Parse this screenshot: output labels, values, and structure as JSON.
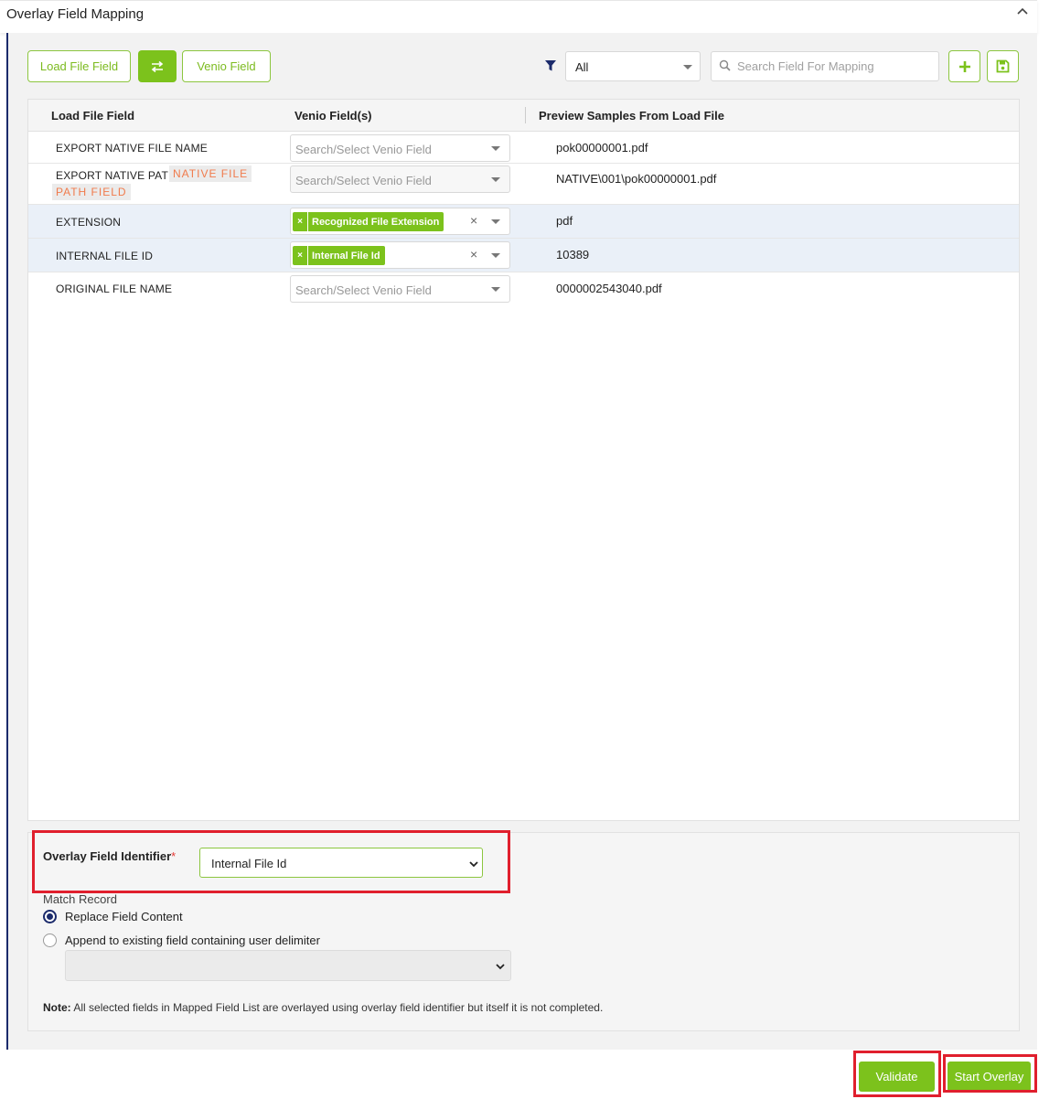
{
  "section": {
    "title": "Overlay Field Mapping"
  },
  "toolbar": {
    "load_file_field_label": "Load File Field",
    "venio_field_label": "Venio Field",
    "filter_value": "All",
    "search_placeholder": "Search Field For Mapping"
  },
  "grid": {
    "headers": {
      "load_file_field": "Load File Field",
      "venio_fields": "Venio Field(s)",
      "preview": "Preview Samples From Load File"
    },
    "rows": [
      {
        "name": "EXPORT NATIVE FILE NAME",
        "venio_placeholder": "Search/Select Venio Field",
        "preview": "pok00000001.pdf"
      },
      {
        "name": "EXPORT NATIVE PATH",
        "tag_line1": "NATIVE FILE",
        "tag_line2": "PATH FIELD",
        "venio_placeholder": "Search/Select Venio Field",
        "preview": "NATIVE\\001\\pok00000001.pdf"
      },
      {
        "name": "EXTENSION",
        "chip": "Recognized File Extension",
        "preview": "pdf"
      },
      {
        "name": "INTERNAL FILE ID",
        "chip": "Internal File Id",
        "preview": "10389"
      },
      {
        "name": "ORIGINAL FILE NAME",
        "venio_placeholder": "Search/Select Venio Field",
        "preview": "0000002543040.pdf"
      }
    ]
  },
  "options": {
    "identifier_label": "Overlay Field Identifier",
    "required_mark": "*",
    "identifier_value": "Internal File Id",
    "match_record_label": "Match Record",
    "radio_replace": "Replace Field Content",
    "radio_append": "Append to existing field containing user delimiter",
    "note_prefix": "Note:",
    "note_text": " All selected fields in Mapped Field List are overlayed using overlay field identifier but itself it is not completed."
  },
  "actions": {
    "validate": "Validate",
    "start_overlay": "Start Overlay"
  },
  "colors": {
    "accent_green": "#7cc21c",
    "navy": "#1b2a6b",
    "highlight_red": "#e01f2d",
    "tag_orange": "#f07b4c"
  }
}
